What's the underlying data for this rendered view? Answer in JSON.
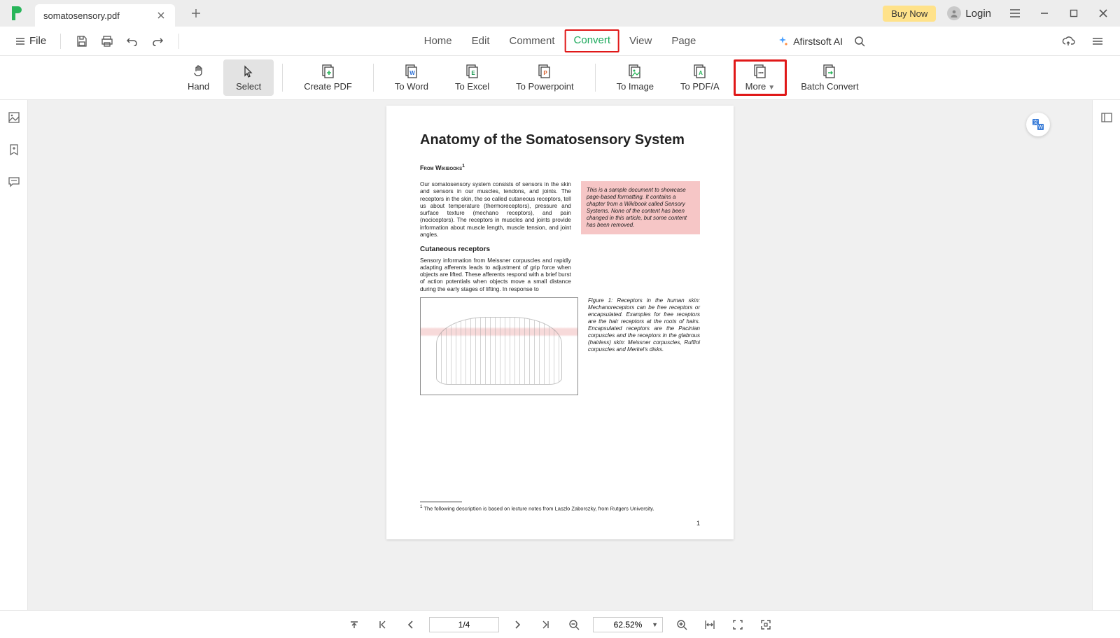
{
  "titlebar": {
    "tab_name": "somatosensory.pdf",
    "buy_now": "Buy Now",
    "login": "Login"
  },
  "menubar": {
    "file": "File",
    "tabs": [
      "Home",
      "Edit",
      "Comment",
      "Convert",
      "View",
      "Page"
    ],
    "active_tab_index": 3,
    "ai_label": "Afirstsoft AI"
  },
  "ribbon": {
    "tools": [
      {
        "label": "Hand",
        "selected": false
      },
      {
        "label": "Select",
        "selected": true
      },
      {
        "label": "Create PDF"
      },
      {
        "label": "To Word"
      },
      {
        "label": "To Excel"
      },
      {
        "label": "To Powerpoint"
      },
      {
        "label": "To Image"
      },
      {
        "label": "To PDF/A"
      },
      {
        "label": "More",
        "highlighted": true
      },
      {
        "label": "Batch Convert"
      }
    ]
  },
  "document": {
    "title": "Anatomy of the Somatosensory System",
    "source_label": "From Wikibooks",
    "source_sup": "1",
    "para1": "Our somatosensory system consists of sensors in the skin and sensors in our muscles, tendons, and joints. The receptors in the skin, the so called cutaneous receptors, tell us about temperature (thermoreceptors), pressure and surface texture (mechano receptors), and pain (nociceptors). The receptors in muscles and joints provide information about muscle length, muscle tension, and joint angles.",
    "sidebox": "This is a sample document to showcase page-based formatting. It contains a chapter from a Wikibook called Sensory Systems. None of the content has been changed in this article, but some content has been removed.",
    "subhead": "Cutaneous receptors",
    "para2": "Sensory information from Meissner corpuscles and rapidly adapting afferents leads to adjustment of grip force when objects are lifted. These afferents respond with a brief burst of action potentials when objects move a small distance during the early stages of lifting. In response to",
    "figcap": "Figure 1: Receptors in the human skin: Mechanoreceptors can be free receptors or encapsulated. Examples for free receptors are the hair receptors at the roots of hairs. Encapsulated receptors are the Pacinian corpuscles and the receptors in the glabrous (hairless) skin: Meissner corpuscles, Ruffini corpuscles and Merkel's disks.",
    "footnote_sup": "1",
    "footnote": "The following description is based on lecture notes from Laszlo Zaborszky, from Rutgers University.",
    "page_number": "1"
  },
  "bottombar": {
    "page_indicator": "1/4",
    "zoom": "62.52%"
  }
}
